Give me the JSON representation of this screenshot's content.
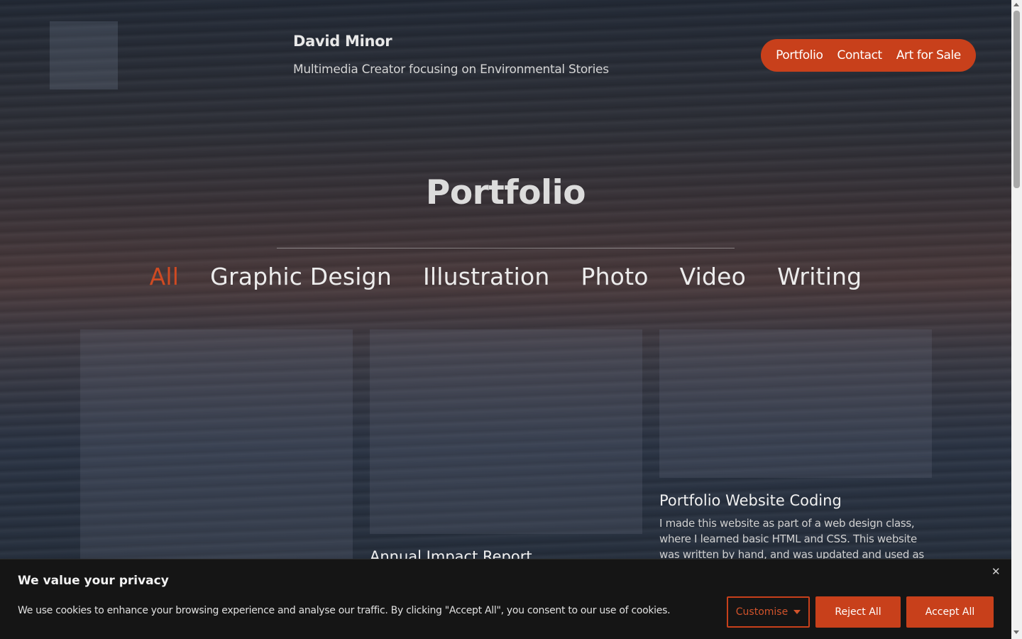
{
  "header": {
    "site_name": "David Minor",
    "tagline": "Multimedia Creator focusing on Environmental Stories",
    "logo_icon": "logo-placeholder"
  },
  "nav": {
    "items": [
      {
        "label": "Portfolio"
      },
      {
        "label": "Contact"
      },
      {
        "label": "Art for Sale"
      }
    ],
    "accent": "#c8401b"
  },
  "main": {
    "title": "Portfolio",
    "filters": [
      {
        "label": "All",
        "active": true
      },
      {
        "label": "Graphic Design",
        "active": false
      },
      {
        "label": "Illustration",
        "active": false
      },
      {
        "label": "Photo",
        "active": false
      },
      {
        "label": "Video",
        "active": false
      },
      {
        "label": "Writing",
        "active": false
      }
    ],
    "active_filter_color": "#cf4a22",
    "cards": [
      {
        "title": "",
        "description": ""
      },
      {
        "title": "Annual Impact Report",
        "description": ""
      },
      {
        "title": "Portfolio Website Coding",
        "description": "I made this website as part of a web design class, where I learned basic HTML and CSS. This website was written by hand, and was updated and used as"
      }
    ]
  },
  "cookie_banner": {
    "title": "We value your privacy",
    "text": "We use cookies to enhance your browsing experience and analyse our traffic. By clicking \"Accept All\", you consent to our use of cookies.",
    "close_icon": "close-icon",
    "customise_label": "Customise",
    "customise_icon": "caret-down-icon",
    "reject_label": "Reject All",
    "accept_label": "Accept All"
  }
}
